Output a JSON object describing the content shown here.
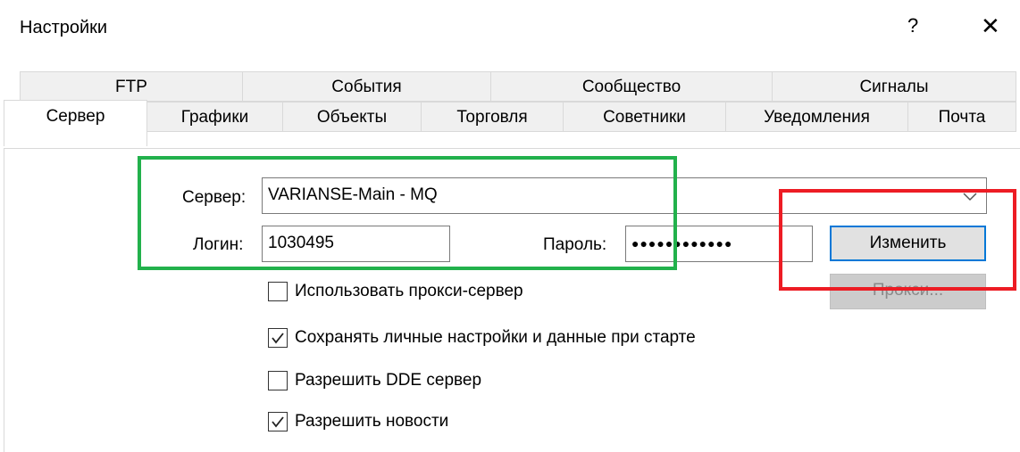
{
  "window": {
    "title": "Настройки",
    "help_glyph": "?",
    "close_glyph": "✕"
  },
  "tabs_row1": [
    {
      "label": "FTP"
    },
    {
      "label": "События"
    },
    {
      "label": "Сообщество"
    },
    {
      "label": "Сигналы"
    }
  ],
  "tabs_row2": [
    {
      "label": "Сервер",
      "active": true
    },
    {
      "label": "Графики"
    },
    {
      "label": "Объекты"
    },
    {
      "label": "Торговля"
    },
    {
      "label": "Советники"
    },
    {
      "label": "Уведомления"
    },
    {
      "label": "Почта"
    }
  ],
  "server": {
    "label": "Сервер:",
    "value": "VARIANSE-Main - MQ"
  },
  "login": {
    "label": "Логин:",
    "value": "1030495"
  },
  "password": {
    "label": "Пароль:",
    "value": "●●●●●●●●●●●●"
  },
  "buttons": {
    "change": "Изменить",
    "proxy": "Прокси..."
  },
  "checkboxes": [
    {
      "label": "Использовать прокси-сервер",
      "checked": false
    },
    {
      "label": "Сохранять личные настройки и данные при старте",
      "checked": true
    },
    {
      "label": "Разрешить DDE сервер",
      "checked": false
    },
    {
      "label": "Разрешить новости",
      "checked": true
    }
  ],
  "colors": {
    "highlight_green": "#22b14c",
    "highlight_red": "#ed1c24",
    "focus_blue": "#0078d7"
  }
}
